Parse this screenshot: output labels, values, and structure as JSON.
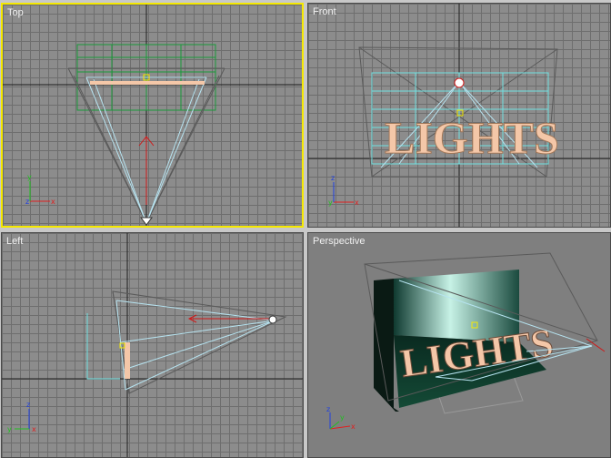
{
  "viewports": {
    "top": {
      "label": "Top",
      "active": true
    },
    "front": {
      "label": "Front",
      "active": false
    },
    "left": {
      "label": "Left",
      "active": false
    },
    "perspective": {
      "label": "Perspective",
      "active": false
    }
  },
  "scene_text": "LIGHTS",
  "axis_labels": {
    "x": "x",
    "y": "y",
    "z": "z"
  },
  "colors": {
    "active_border": "#f5e800",
    "grid_bg": "#8c8c8c",
    "grid_line": "#6e6e6e",
    "grid_axis": "#1e1e1e",
    "spot_cone": "#b6e3f0",
    "wire_gray": "#5a5a5a",
    "green_box": "#1a9a3a",
    "cyan_mesh": "#6fe0e0",
    "text_fill": "#f4c7a8",
    "target_red": "#d01818"
  }
}
